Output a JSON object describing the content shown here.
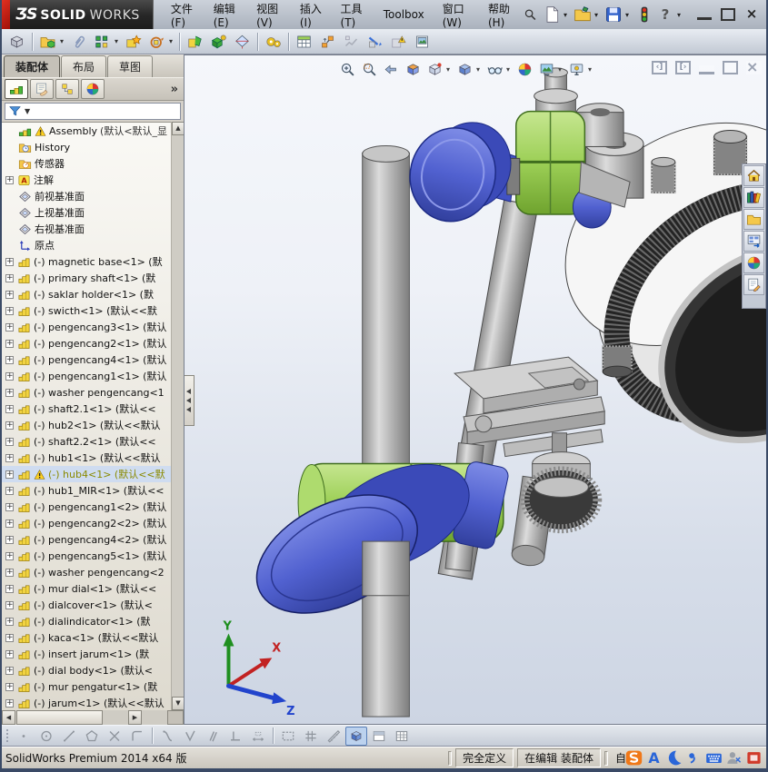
{
  "colors": {
    "red_accent": "#c01810",
    "green_part": "#9ccf56",
    "blue_part": "#5161d0",
    "viewport_top": "#f5f7fb",
    "viewport_bottom": "#cdd5e3",
    "warn_yellow": "#ffd21f",
    "selected_tree_bg": "#cfdcf0",
    "selected_tree_text": "#8a8a00"
  },
  "titlebar": {
    "logo_prefix": "ƷS",
    "logo_bold": "SOLID",
    "logo_light": "WORKS",
    "menus": [
      "文件(F)",
      "编辑(E)",
      "视图(V)",
      "插入(I)",
      "工具(T)",
      "Toolbox",
      "窗口(W)",
      "帮助(H)"
    ],
    "quick": [
      "new-document",
      "open-document",
      "save-document",
      "performance-monitor",
      "help"
    ],
    "window_controls": [
      "minimize",
      "maximize",
      "close"
    ]
  },
  "assembly_toolbar": [
    "edit-component",
    "insert-component",
    "mate",
    "linear-component-pattern",
    "smart-fasteners",
    "move-component",
    "show-hidden-components",
    "assembly-features",
    "reference-geometry",
    "motion-study",
    "bill-of-materials",
    "exploded-view",
    "explode-line-sketch",
    "interference-detection",
    "assembly-visualization",
    "preview-window"
  ],
  "panel": {
    "tabs": [
      {
        "label": "装配体",
        "active": true
      },
      {
        "label": "布局",
        "active": false
      },
      {
        "label": "草图",
        "active": false
      }
    ],
    "fm_tabs": [
      "featuremanager",
      "propertymanager",
      "configurationmanager",
      "displaymanager"
    ],
    "overflow": "»"
  },
  "tree": [
    {
      "icon": "assembly",
      "warn": true,
      "label": "Assembly",
      "suffix": "(默认<默认_显",
      "root": true
    },
    {
      "icon": "history",
      "label": "History"
    },
    {
      "icon": "sensors",
      "label": "传感器"
    },
    {
      "icon": "annotations",
      "label": "注解",
      "plus": true
    },
    {
      "icon": "plane",
      "label": "前视基准面"
    },
    {
      "icon": "plane",
      "label": "上视基准面"
    },
    {
      "icon": "plane",
      "label": "右视基准面"
    },
    {
      "icon": "origin",
      "label": "原点"
    },
    {
      "icon": "part",
      "plus": true,
      "label": "(-) magnetic base<1> (默"
    },
    {
      "icon": "part",
      "plus": true,
      "label": "(-) primary shaft<1> (默"
    },
    {
      "icon": "part",
      "plus": true,
      "label": "(-) saklar holder<1> (默"
    },
    {
      "icon": "part",
      "plus": true,
      "label": "(-) swicth<1> (默认<<默"
    },
    {
      "icon": "part",
      "plus": true,
      "label": "(-) pengencang3<1> (默认"
    },
    {
      "icon": "part",
      "plus": true,
      "label": "(-) pengencang2<1> (默认"
    },
    {
      "icon": "part",
      "plus": true,
      "label": "(-) pengencang4<1> (默认"
    },
    {
      "icon": "part",
      "plus": true,
      "label": "(-) pengencang1<1> (默认"
    },
    {
      "icon": "part",
      "plus": true,
      "label": "(-) washer pengencang<1"
    },
    {
      "icon": "part",
      "plus": true,
      "label": "(-) shaft2.1<1> (默认<<"
    },
    {
      "icon": "part",
      "plus": true,
      "label": "(-) hub2<1> (默认<<默认"
    },
    {
      "icon": "part",
      "plus": true,
      "label": "(-) shaft2.2<1> (默认<<"
    },
    {
      "icon": "part",
      "plus": true,
      "label": "(-) hub1<1> (默认<<默认"
    },
    {
      "icon": "part",
      "plus": true,
      "warn": true,
      "selected": true,
      "label": "(-) hub4<1> (默认<<默"
    },
    {
      "icon": "part",
      "plus": true,
      "label": "(-) hub1_MIR<1> (默认<<"
    },
    {
      "icon": "part",
      "plus": true,
      "label": "(-) pengencang1<2> (默认"
    },
    {
      "icon": "part",
      "plus": true,
      "label": "(-) pengencang2<2> (默认"
    },
    {
      "icon": "part",
      "plus": true,
      "label": "(-) pengencang4<2> (默认"
    },
    {
      "icon": "part",
      "plus": true,
      "label": "(-) pengencang5<1> (默认"
    },
    {
      "icon": "part",
      "plus": true,
      "label": "(-) washer pengencang<2"
    },
    {
      "icon": "part",
      "plus": true,
      "label": "(-) mur dial<1> (默认<<"
    },
    {
      "icon": "part",
      "plus": true,
      "label": "(-) dialcover<1> (默认<"
    },
    {
      "icon": "part",
      "plus": true,
      "label": "(-) dialindicator<1> (默"
    },
    {
      "icon": "part",
      "plus": true,
      "label": "(-) kaca<1> (默认<<默认"
    },
    {
      "icon": "part",
      "plus": true,
      "label": "(-) insert jarum<1> (默"
    },
    {
      "icon": "part",
      "plus": true,
      "label": "(-) dial body<1> (默认<"
    },
    {
      "icon": "part",
      "plus": true,
      "label": "(-) mur pengatur<1> (默"
    },
    {
      "icon": "part",
      "plus": true,
      "label": "(-) jarum<1> (默认<<默认"
    }
  ],
  "viewport": {
    "hud": [
      {
        "n": "zoom-to-fit"
      },
      {
        "n": "zoom-to-area"
      },
      {
        "n": "previous-view"
      },
      {
        "n": "section-view"
      },
      {
        "n": "view-orientation",
        "drop": true
      },
      {
        "n": "display-style",
        "drop": true
      },
      {
        "n": "hide-show-items",
        "drop": true
      },
      {
        "n": "edit-appearance"
      },
      {
        "n": "apply-scene",
        "drop": true
      },
      {
        "n": "view-settings",
        "drop": true
      }
    ],
    "window_controls": [
      "collapse-left-pane",
      "collapse-right-pane",
      "minimize-document",
      "restore-document",
      "close-document"
    ],
    "triad": {
      "x": "X",
      "y": "Y",
      "z": "Z"
    }
  },
  "taskpane": [
    "solidworks-resources",
    "design-library",
    "file-explorer",
    "view-palette",
    "appearances-scenes",
    "custom-properties"
  ],
  "sketchbar": [
    {
      "n": "sketch-point"
    },
    {
      "n": "sketch-circle"
    },
    {
      "n": "sketch-line"
    },
    {
      "n": "sketch-polygon"
    },
    {
      "n": "trim-entities"
    },
    {
      "n": "sketch-fillet"
    },
    {
      "sep": true
    },
    {
      "n": "add-relation"
    },
    {
      "n": "vertical-relation"
    },
    {
      "n": "parallel-relation"
    },
    {
      "n": "perpendicular-relation"
    },
    {
      "n": "smart-dimension"
    },
    {
      "sep": true
    },
    {
      "n": "fully-define-sketch"
    },
    {
      "n": "grid-snap"
    },
    {
      "n": "measure"
    },
    {
      "n": "shaded-with-edges",
      "active": true
    },
    {
      "n": "split-window"
    },
    {
      "n": "design-table"
    }
  ],
  "statusbar": {
    "left": "SolidWorks Premium 2014 x64 版",
    "define_state": "完全定义",
    "edit_state": "在编辑 装配体",
    "ime_prefix": "自",
    "ime": [
      "sogou-input",
      "font-style",
      "half-full-moon",
      "punctuation",
      "soft-keyboard",
      "account-tools",
      "skin-manager"
    ]
  }
}
